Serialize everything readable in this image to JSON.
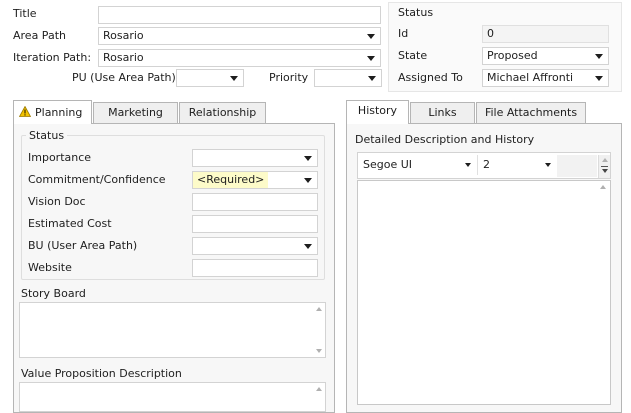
{
  "header": {
    "title_label": "Title",
    "title_value": "",
    "area_path_label": "Area Path",
    "area_path_value": "Rosario",
    "iteration_path_label": "Iteration Path:",
    "iteration_path_value": "Rosario",
    "pu_label": "PU (Use Area Path)",
    "pu_value": "",
    "priority_label": "Priority",
    "priority_value": ""
  },
  "status": {
    "group_label": "Status",
    "id_label": "Id",
    "id_value": "0",
    "state_label": "State",
    "state_value": "Proposed",
    "assigned_to_label": "Assigned To",
    "assigned_to_value": "Michael Affronti"
  },
  "left_tabs": [
    {
      "label": "Planning",
      "icon": "warning-icon",
      "active": true
    },
    {
      "label": "Marketing",
      "active": false
    },
    {
      "label": "Relationship",
      "active": false
    }
  ],
  "planning": {
    "status_group_label": "Status",
    "importance_label": "Importance",
    "importance_value": "",
    "commitment_label": "Commitment/Confidence",
    "commitment_value": "<Required>",
    "vision_doc_label": "Vision Doc",
    "vision_doc_value": "",
    "estimated_cost_label": "Estimated Cost",
    "estimated_cost_value": "",
    "bu_label": "BU (User Area Path)",
    "bu_value": "",
    "website_label": "Website",
    "website_value": "",
    "story_board_label": "Story Board",
    "value_prop_label": "Value Proposition Description"
  },
  "right_tabs": [
    {
      "label": "History",
      "active": true
    },
    {
      "label": "Links",
      "active": false
    },
    {
      "label": "File Attachments",
      "active": false
    }
  ],
  "history": {
    "description_label": "Detailed Description and History",
    "font_value": "Segoe UI",
    "font_size_value": "2"
  },
  "colors": {
    "required_highlight": "#fdfbc9",
    "warning": "#f2c200",
    "border": "#b5b5b5"
  }
}
